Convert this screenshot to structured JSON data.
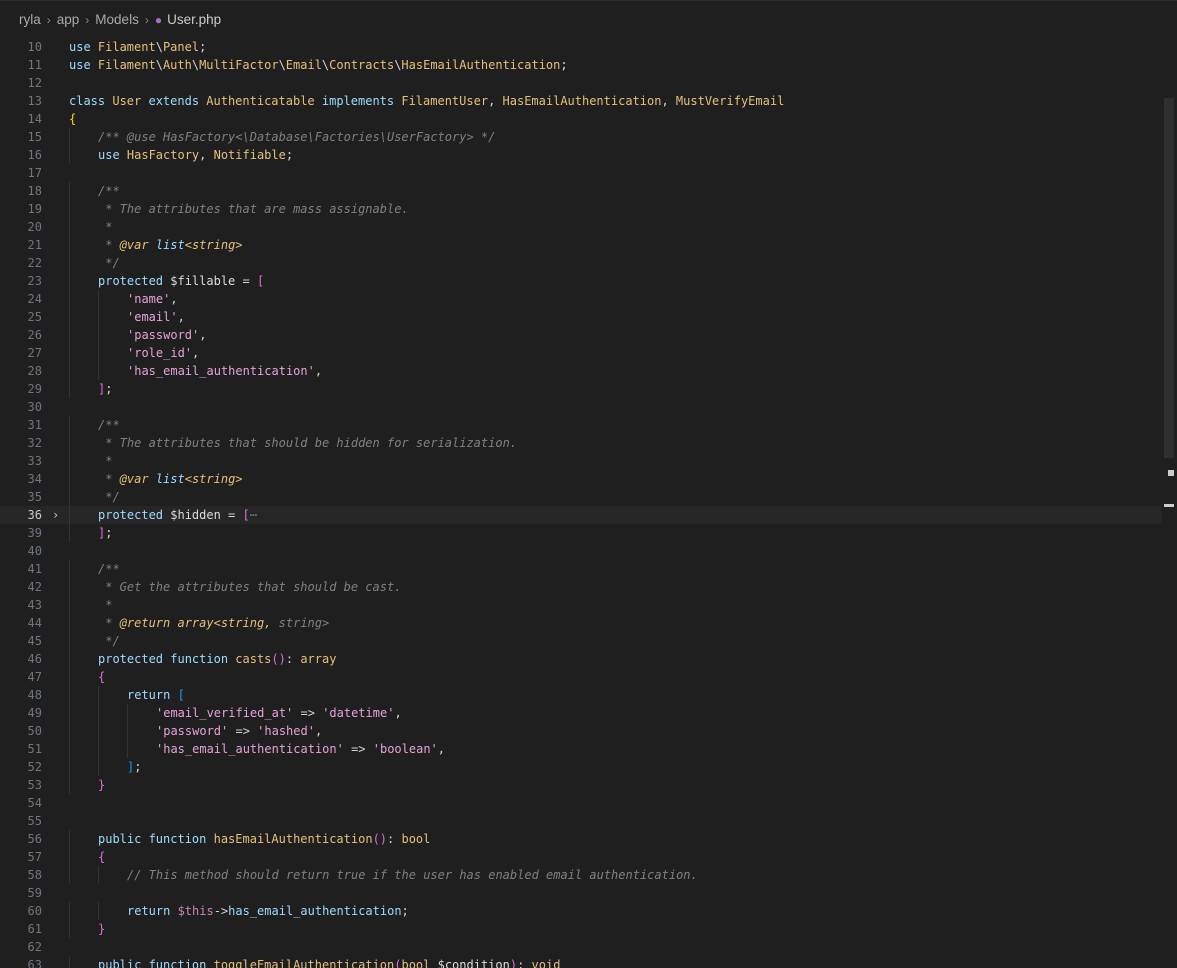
{
  "breadcrumb": {
    "items": [
      "ryla",
      "app",
      "Models"
    ],
    "file": "User.php",
    "file_icon": "php-elephant-icon"
  },
  "editor": {
    "current_line": "36",
    "lines": [
      {
        "n": "10",
        "indent": 0,
        "tokens": [
          [
            "kw2",
            "use "
          ],
          [
            "ns",
            "Filament"
          ],
          [
            "op",
            "\\"
          ],
          [
            "cls",
            "Panel"
          ],
          [
            "op",
            ";"
          ]
        ]
      },
      {
        "n": "11",
        "indent": 0,
        "tokens": [
          [
            "kw2",
            "use "
          ],
          [
            "ns",
            "Filament"
          ],
          [
            "op",
            "\\"
          ],
          [
            "ns",
            "Auth"
          ],
          [
            "op",
            "\\"
          ],
          [
            "ns",
            "MultiFactor"
          ],
          [
            "op",
            "\\"
          ],
          [
            "ns",
            "Email"
          ],
          [
            "op",
            "\\"
          ],
          [
            "ns",
            "Contracts"
          ],
          [
            "op",
            "\\"
          ],
          [
            "cls",
            "HasEmailAuthentication"
          ],
          [
            "op",
            ";"
          ]
        ]
      },
      {
        "n": "12",
        "indent": 0,
        "tokens": []
      },
      {
        "n": "13",
        "indent": 0,
        "tokens": [
          [
            "kw2",
            "class "
          ],
          [
            "cls",
            "User "
          ],
          [
            "kw2",
            "extends "
          ],
          [
            "cls",
            "Authenticatable "
          ],
          [
            "kw2",
            "implements "
          ],
          [
            "cls",
            "FilamentUser"
          ],
          [
            "op",
            ", "
          ],
          [
            "cls",
            "HasEmailAuthentication"
          ],
          [
            "op",
            ", "
          ],
          [
            "cls",
            "MustVerifyEmail"
          ]
        ]
      },
      {
        "n": "14",
        "indent": 0,
        "tokens": [
          [
            "brk1",
            "{"
          ]
        ]
      },
      {
        "n": "15",
        "indent": 1,
        "tokens": [
          [
            "cmt",
            "/** @use HasFactory<\\Database\\Factories\\UserFactory> */"
          ]
        ]
      },
      {
        "n": "16",
        "indent": 1,
        "tokens": [
          [
            "kw2",
            "use "
          ],
          [
            "cls",
            "HasFactory"
          ],
          [
            "op",
            ", "
          ],
          [
            "cls",
            "Notifiable"
          ],
          [
            "op",
            ";"
          ]
        ]
      },
      {
        "n": "17",
        "indent": 0,
        "tokens": []
      },
      {
        "n": "18",
        "indent": 1,
        "tokens": [
          [
            "cmt",
            "/**"
          ]
        ]
      },
      {
        "n": "19",
        "indent": 1,
        "tokens": [
          [
            "cmt",
            " * The attributes that are mass assignable."
          ]
        ]
      },
      {
        "n": "20",
        "indent": 1,
        "tokens": [
          [
            "cmt",
            " *"
          ]
        ]
      },
      {
        "n": "21",
        "indent": 1,
        "tokens": [
          [
            "cmt",
            " * "
          ],
          [
            "doctag",
            "@var "
          ],
          [
            "doctype",
            "list"
          ],
          [
            "doctag",
            "<string>"
          ]
        ]
      },
      {
        "n": "22",
        "indent": 1,
        "tokens": [
          [
            "cmt",
            " */"
          ]
        ]
      },
      {
        "n": "23",
        "indent": 1,
        "tokens": [
          [
            "kw2",
            "protected "
          ],
          [
            "var",
            "$fillable"
          ],
          [
            "op",
            " = "
          ],
          [
            "brk2",
            "["
          ]
        ]
      },
      {
        "n": "24",
        "indent": 2,
        "tokens": [
          [
            "str",
            "'name'"
          ],
          [
            "op",
            ","
          ]
        ]
      },
      {
        "n": "25",
        "indent": 2,
        "tokens": [
          [
            "str",
            "'email'"
          ],
          [
            "op",
            ","
          ]
        ]
      },
      {
        "n": "26",
        "indent": 2,
        "tokens": [
          [
            "str",
            "'password'"
          ],
          [
            "op",
            ","
          ]
        ]
      },
      {
        "n": "27",
        "indent": 2,
        "tokens": [
          [
            "str",
            "'role_id'"
          ],
          [
            "op",
            ","
          ]
        ]
      },
      {
        "n": "28",
        "indent": 2,
        "tokens": [
          [
            "str",
            "'has_email_authentication'"
          ],
          [
            "op",
            ","
          ]
        ]
      },
      {
        "n": "29",
        "indent": 1,
        "tokens": [
          [
            "brk2",
            "]"
          ],
          [
            "op",
            ";"
          ]
        ]
      },
      {
        "n": "30",
        "indent": 0,
        "tokens": []
      },
      {
        "n": "31",
        "indent": 1,
        "tokens": [
          [
            "cmt",
            "/**"
          ]
        ]
      },
      {
        "n": "32",
        "indent": 1,
        "tokens": [
          [
            "cmt",
            " * The attributes that should be hidden for serialization."
          ]
        ]
      },
      {
        "n": "33",
        "indent": 1,
        "tokens": [
          [
            "cmt",
            " *"
          ]
        ]
      },
      {
        "n": "34",
        "indent": 1,
        "tokens": [
          [
            "cmt",
            " * "
          ],
          [
            "doctag",
            "@var "
          ],
          [
            "doctype",
            "list"
          ],
          [
            "doctag",
            "<string>"
          ]
        ]
      },
      {
        "n": "35",
        "indent": 1,
        "tokens": [
          [
            "cmt",
            " */"
          ]
        ]
      },
      {
        "n": "36",
        "indent": 1,
        "folded": true,
        "tokens": [
          [
            "kw2",
            "protected "
          ],
          [
            "var",
            "$hidden"
          ],
          [
            "op",
            " = "
          ],
          [
            "brk2",
            "["
          ],
          [
            "cmt",
            "⋯"
          ]
        ]
      },
      {
        "n": "39",
        "indent": 1,
        "tokens": [
          [
            "brk2",
            "]"
          ],
          [
            "op",
            ";"
          ]
        ]
      },
      {
        "n": "40",
        "indent": 0,
        "tokens": []
      },
      {
        "n": "41",
        "indent": 1,
        "tokens": [
          [
            "cmt",
            "/**"
          ]
        ]
      },
      {
        "n": "42",
        "indent": 1,
        "tokens": [
          [
            "cmt",
            " * Get the attributes that should be cast."
          ]
        ]
      },
      {
        "n": "43",
        "indent": 1,
        "tokens": [
          [
            "cmt",
            " *"
          ]
        ]
      },
      {
        "n": "44",
        "indent": 1,
        "tokens": [
          [
            "cmt",
            " * "
          ],
          [
            "doctag",
            "@return "
          ],
          [
            "doctag",
            "array<string, "
          ],
          [
            "cmt",
            "string>"
          ]
        ]
      },
      {
        "n": "45",
        "indent": 1,
        "tokens": [
          [
            "cmt",
            " */"
          ]
        ]
      },
      {
        "n": "46",
        "indent": 1,
        "tokens": [
          [
            "kw2",
            "protected "
          ],
          [
            "kw2",
            "function "
          ],
          [
            "fn",
            "casts"
          ],
          [
            "brk2",
            "()"
          ],
          [
            "op",
            ": "
          ],
          [
            "typ",
            "array"
          ]
        ]
      },
      {
        "n": "47",
        "indent": 1,
        "tokens": [
          [
            "brk2",
            "{"
          ]
        ]
      },
      {
        "n": "48",
        "indent": 2,
        "tokens": [
          [
            "kw2",
            "return "
          ],
          [
            "brk3",
            "["
          ]
        ]
      },
      {
        "n": "49",
        "indent": 3,
        "tokens": [
          [
            "str",
            "'email_verified_at'"
          ],
          [
            "op",
            " => "
          ],
          [
            "str",
            "'datetime'"
          ],
          [
            "op",
            ","
          ]
        ]
      },
      {
        "n": "50",
        "indent": 3,
        "tokens": [
          [
            "str",
            "'password'"
          ],
          [
            "op",
            " => "
          ],
          [
            "str",
            "'hashed'"
          ],
          [
            "op",
            ","
          ]
        ]
      },
      {
        "n": "51",
        "indent": 3,
        "tokens": [
          [
            "str",
            "'has_email_authentication'"
          ],
          [
            "op",
            " => "
          ],
          [
            "str",
            "'boolean'"
          ],
          [
            "op",
            ","
          ]
        ]
      },
      {
        "n": "52",
        "indent": 2,
        "tokens": [
          [
            "brk3",
            "]"
          ],
          [
            "op",
            ";"
          ]
        ]
      },
      {
        "n": "53",
        "indent": 1,
        "tokens": [
          [
            "brk2",
            "}"
          ]
        ]
      },
      {
        "n": "54",
        "indent": 0,
        "tokens": []
      },
      {
        "n": "55",
        "indent": 0,
        "tokens": []
      },
      {
        "n": "56",
        "indent": 1,
        "tokens": [
          [
            "kw2",
            "public "
          ],
          [
            "kw2",
            "function "
          ],
          [
            "fn",
            "hasEmailAuthentication"
          ],
          [
            "brk2",
            "()"
          ],
          [
            "op",
            ": "
          ],
          [
            "typ",
            "bool"
          ]
        ]
      },
      {
        "n": "57",
        "indent": 1,
        "tokens": [
          [
            "brk2",
            "{"
          ]
        ]
      },
      {
        "n": "58",
        "indent": 2,
        "tokens": [
          [
            "cmt",
            "// This method should return true if the user has enabled email authentication."
          ]
        ]
      },
      {
        "n": "59",
        "indent": 0,
        "tokens": []
      },
      {
        "n": "60",
        "indent": 2,
        "tokens": [
          [
            "kw2",
            "return "
          ],
          [
            "thisv",
            "$this"
          ],
          [
            "op",
            "->"
          ],
          [
            "prop",
            "has_email_authentication"
          ],
          [
            "op",
            ";"
          ]
        ]
      },
      {
        "n": "61",
        "indent": 1,
        "tokens": [
          [
            "brk2",
            "}"
          ]
        ]
      },
      {
        "n": "62",
        "indent": 0,
        "tokens": []
      },
      {
        "n": "63",
        "indent": 1,
        "tokens": [
          [
            "kw2",
            "public "
          ],
          [
            "kw2",
            "function "
          ],
          [
            "fn",
            "toggleEmailAuthentication"
          ],
          [
            "brk2",
            "("
          ],
          [
            "typ",
            "bool "
          ],
          [
            "var",
            "$condition"
          ],
          [
            "brk2",
            ")"
          ],
          [
            "op",
            ": "
          ],
          [
            "typ",
            "void"
          ]
        ]
      }
    ]
  }
}
